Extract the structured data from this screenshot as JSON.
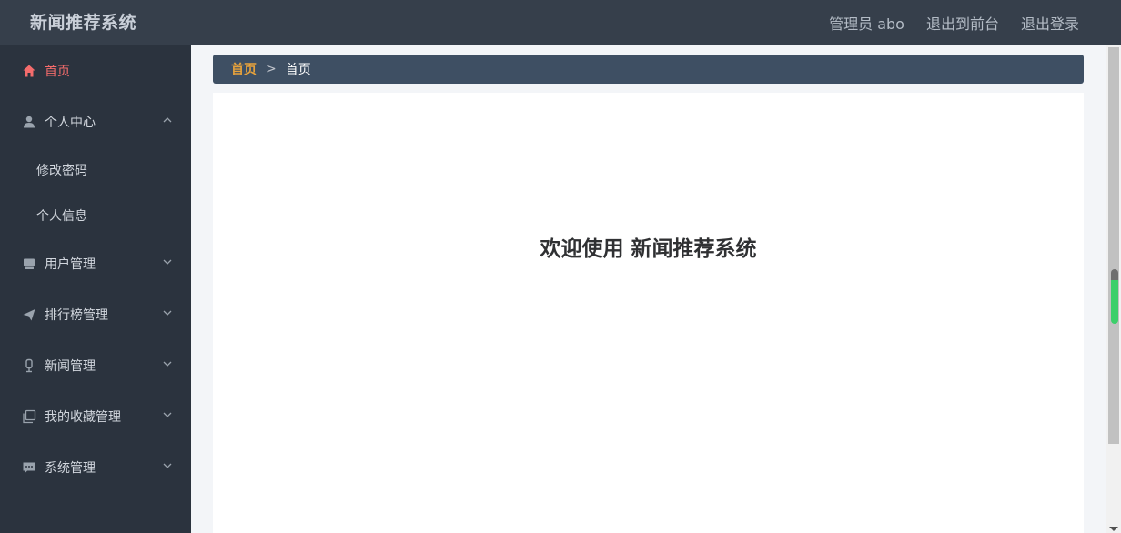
{
  "header": {
    "title": "新闻推荐系统",
    "user": "管理员 abo",
    "to_front": "退出到前台",
    "logout": "退出登录"
  },
  "sidebar": {
    "items": [
      {
        "label": "首页",
        "icon": "home-icon",
        "active": true
      },
      {
        "label": "个人中心",
        "icon": "user-icon",
        "expanded": true,
        "children": [
          {
            "label": "修改密码"
          },
          {
            "label": "个人信息"
          }
        ]
      },
      {
        "label": "用户管理",
        "icon": "monitor-icon"
      },
      {
        "label": "排行榜管理",
        "icon": "paper-plane-icon"
      },
      {
        "label": "新闻管理",
        "icon": "microphone-icon"
      },
      {
        "label": "我的收藏管理",
        "icon": "copy-icon"
      },
      {
        "label": "系统管理",
        "icon": "chat-icon"
      }
    ]
  },
  "breadcrumb": {
    "home": "首页",
    "separator": ">",
    "current": "首页"
  },
  "main": {
    "welcome": "欢迎使用 新闻推荐系统"
  },
  "colors": {
    "header_bg": "#363f4b",
    "sidebar_bg": "#2b333e",
    "active": "#f56c6c",
    "breadcrumb_bg": "#3e4f63",
    "breadcrumb_home": "#e6a23c"
  }
}
